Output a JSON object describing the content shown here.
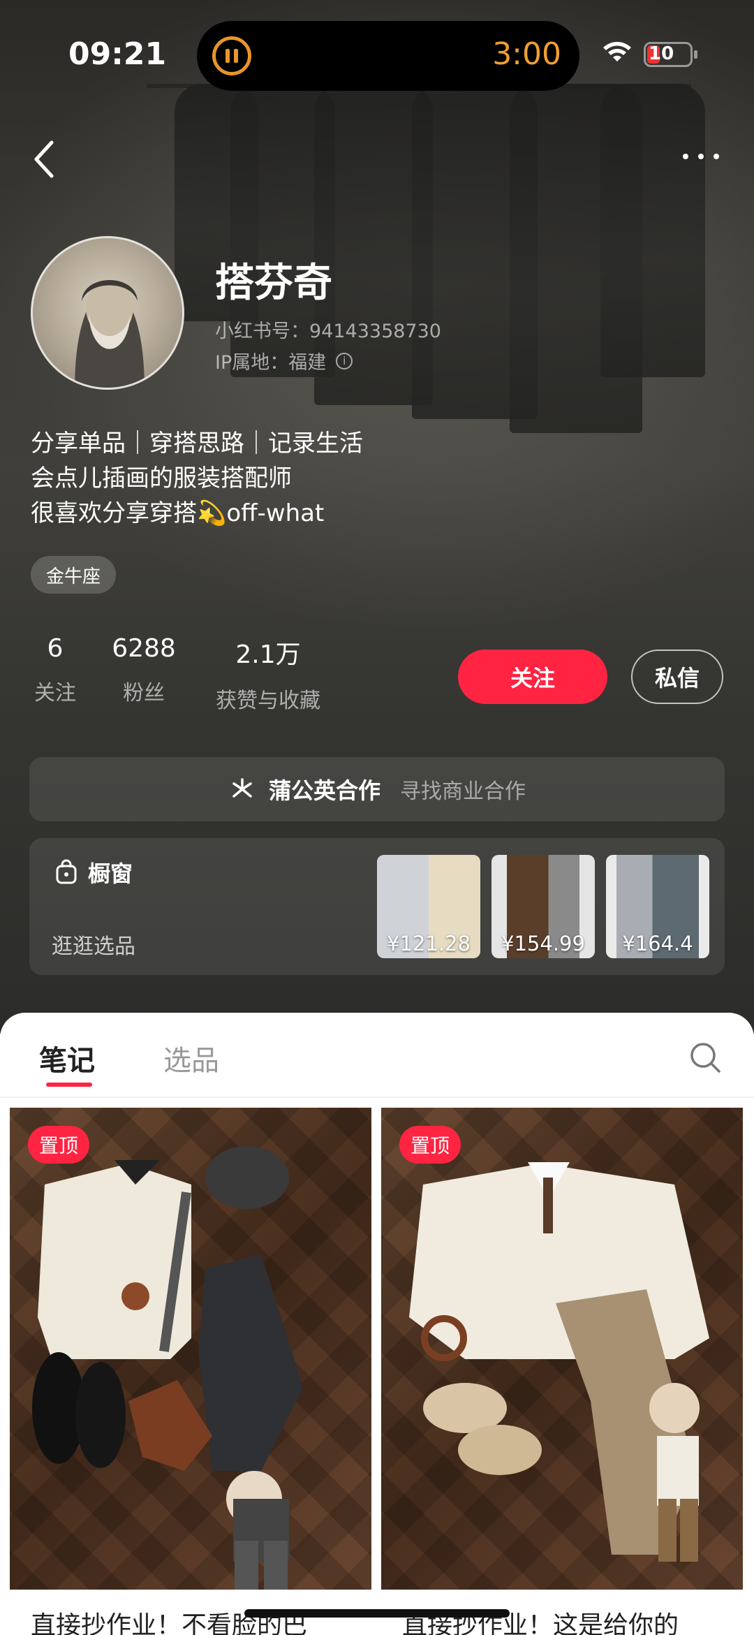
{
  "status_bar": {
    "time": "09:21",
    "timer": "3:00",
    "battery": "10"
  },
  "profile": {
    "nickname": "搭芬奇",
    "rednote_id": "小红书号：94143358730",
    "ip_location": "IP属地：福建",
    "bio": [
      "分享单品｜穿搭思路｜记录生活",
      "会点儿插画的服装搭配师",
      "很喜欢分享穿搭💫off-what"
    ],
    "tag": "金牛座"
  },
  "stats": [
    {
      "value": "6",
      "label": "关注"
    },
    {
      "value": "6288",
      "label": "粉丝"
    },
    {
      "value": "2.1万",
      "label": "获赞与收藏"
    }
  ],
  "actions": {
    "follow": "关注",
    "message": "私信"
  },
  "dandelion": {
    "title": "蒲公英合作",
    "subtitle": "寻找商业合作"
  },
  "shop": {
    "title": "橱窗",
    "subtitle": "逛逛选品",
    "products": [
      {
        "price": "¥121.28"
      },
      {
        "price": "¥154.99"
      },
      {
        "price": "¥164.4"
      }
    ]
  },
  "tabs": {
    "notes": "笔记",
    "picks": "选品"
  },
  "notes": [
    {
      "badge": "置顶",
      "title": "直接抄作业！不看脸的巴"
    },
    {
      "badge": "置顶",
      "title": "直接抄作业！这是给你的"
    }
  ],
  "colors": {
    "accent": "#ff2442",
    "timer": "#f0a030"
  }
}
